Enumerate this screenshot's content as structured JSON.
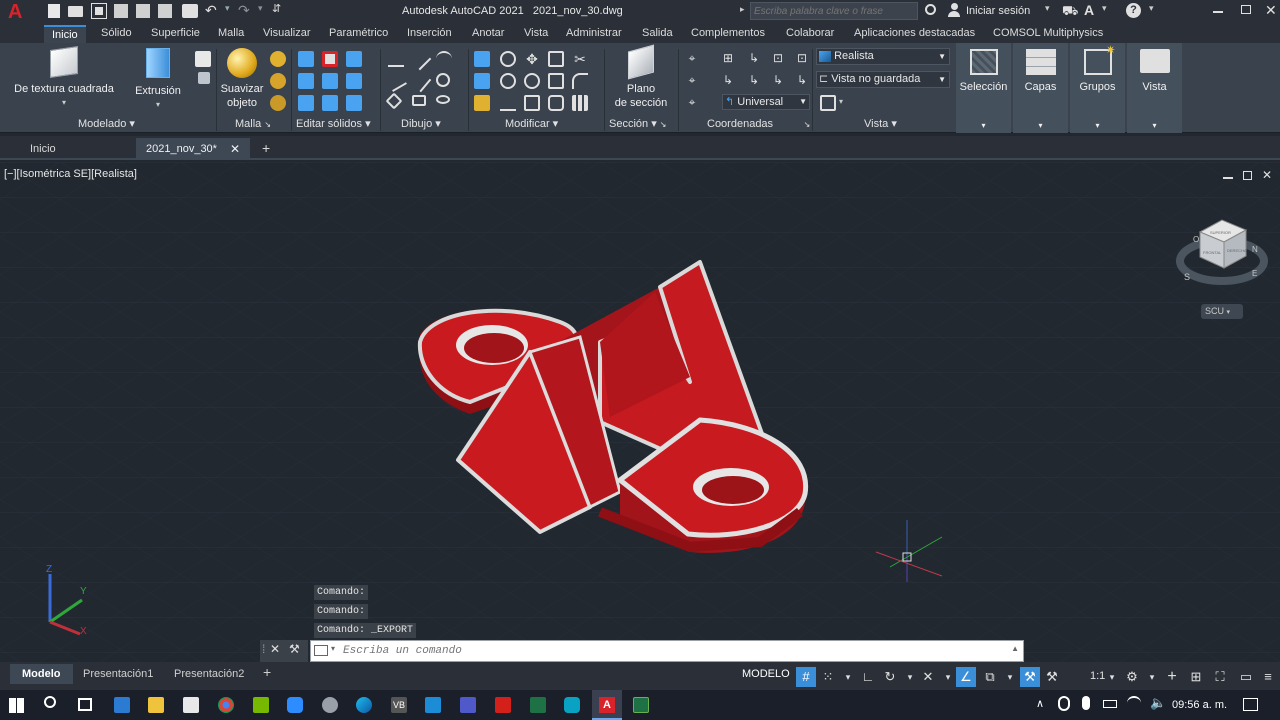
{
  "title": {
    "app": "Autodesk AutoCAD 2021",
    "doc": "2021_nov_30.dwg",
    "search_placeholder": "Escriba palabra clave o frase",
    "login": "Iniciar sesión"
  },
  "ribbon_tabs": [
    "Inicio",
    "Sólido",
    "Superficie",
    "Malla",
    "Visualizar",
    "Paramétrico",
    "Inserción",
    "Anotar",
    "Vista",
    "Administrar",
    "Salida",
    "Complementos",
    "Colaborar",
    "Aplicaciones destacadas",
    "COMSOL Multiphysics"
  ],
  "ribbon": {
    "panels": {
      "modelado": "Modelado",
      "malla": "Malla",
      "editar_solidos": "Editar sólidos",
      "dibujo": "Dibujo",
      "modificar": "Modificar",
      "seccion": "Sección",
      "coordenadas": "Coordenadas",
      "vista": "Vista"
    },
    "buttons": {
      "textura": "De textura cuadrada",
      "extrusion": "Extrusión",
      "suavizar_1": "Suavizar",
      "suavizar_2": "objeto",
      "plano_1": "Plano",
      "plano_2": "de sección",
      "seleccion": "Selección",
      "capas": "Capas",
      "grupos": "Grupos",
      "vista": "Vista"
    },
    "dropdowns": {
      "visual_style": "Realista",
      "named_view": "Vista no guardada",
      "ucs": "Universal"
    }
  },
  "file_tabs": {
    "home": "Inicio",
    "doc": "2021_nov_30*"
  },
  "viewport": {
    "label": "[−][Isométrica SE][Realista]",
    "viewcube": {
      "face_top": "SUPERIOR",
      "face_front": "FRONTAL",
      "face_right": "DERECHA",
      "compass_n": "N",
      "compass_s": "S",
      "compass_e": "E",
      "compass_o": "O"
    },
    "wcs_label": "SCU",
    "ucs_axes": {
      "x": "X",
      "y": "Y",
      "z": "Z"
    }
  },
  "command": {
    "history": [
      "Comando:",
      "Comando:",
      "Comando:  _EXPORT"
    ],
    "placeholder": "Escriba un comando"
  },
  "layout_tabs": [
    "Modelo",
    "Presentación1",
    "Presentación2"
  ],
  "status": {
    "model": "MODELO",
    "scale": "1:1"
  },
  "taskbar": {
    "time": "09:56 a. m."
  },
  "colors": {
    "accent": "#3b8fd9",
    "part_red": "#c4161c",
    "bg_viewport": "#212830",
    "ribbon": "#3a424d"
  }
}
